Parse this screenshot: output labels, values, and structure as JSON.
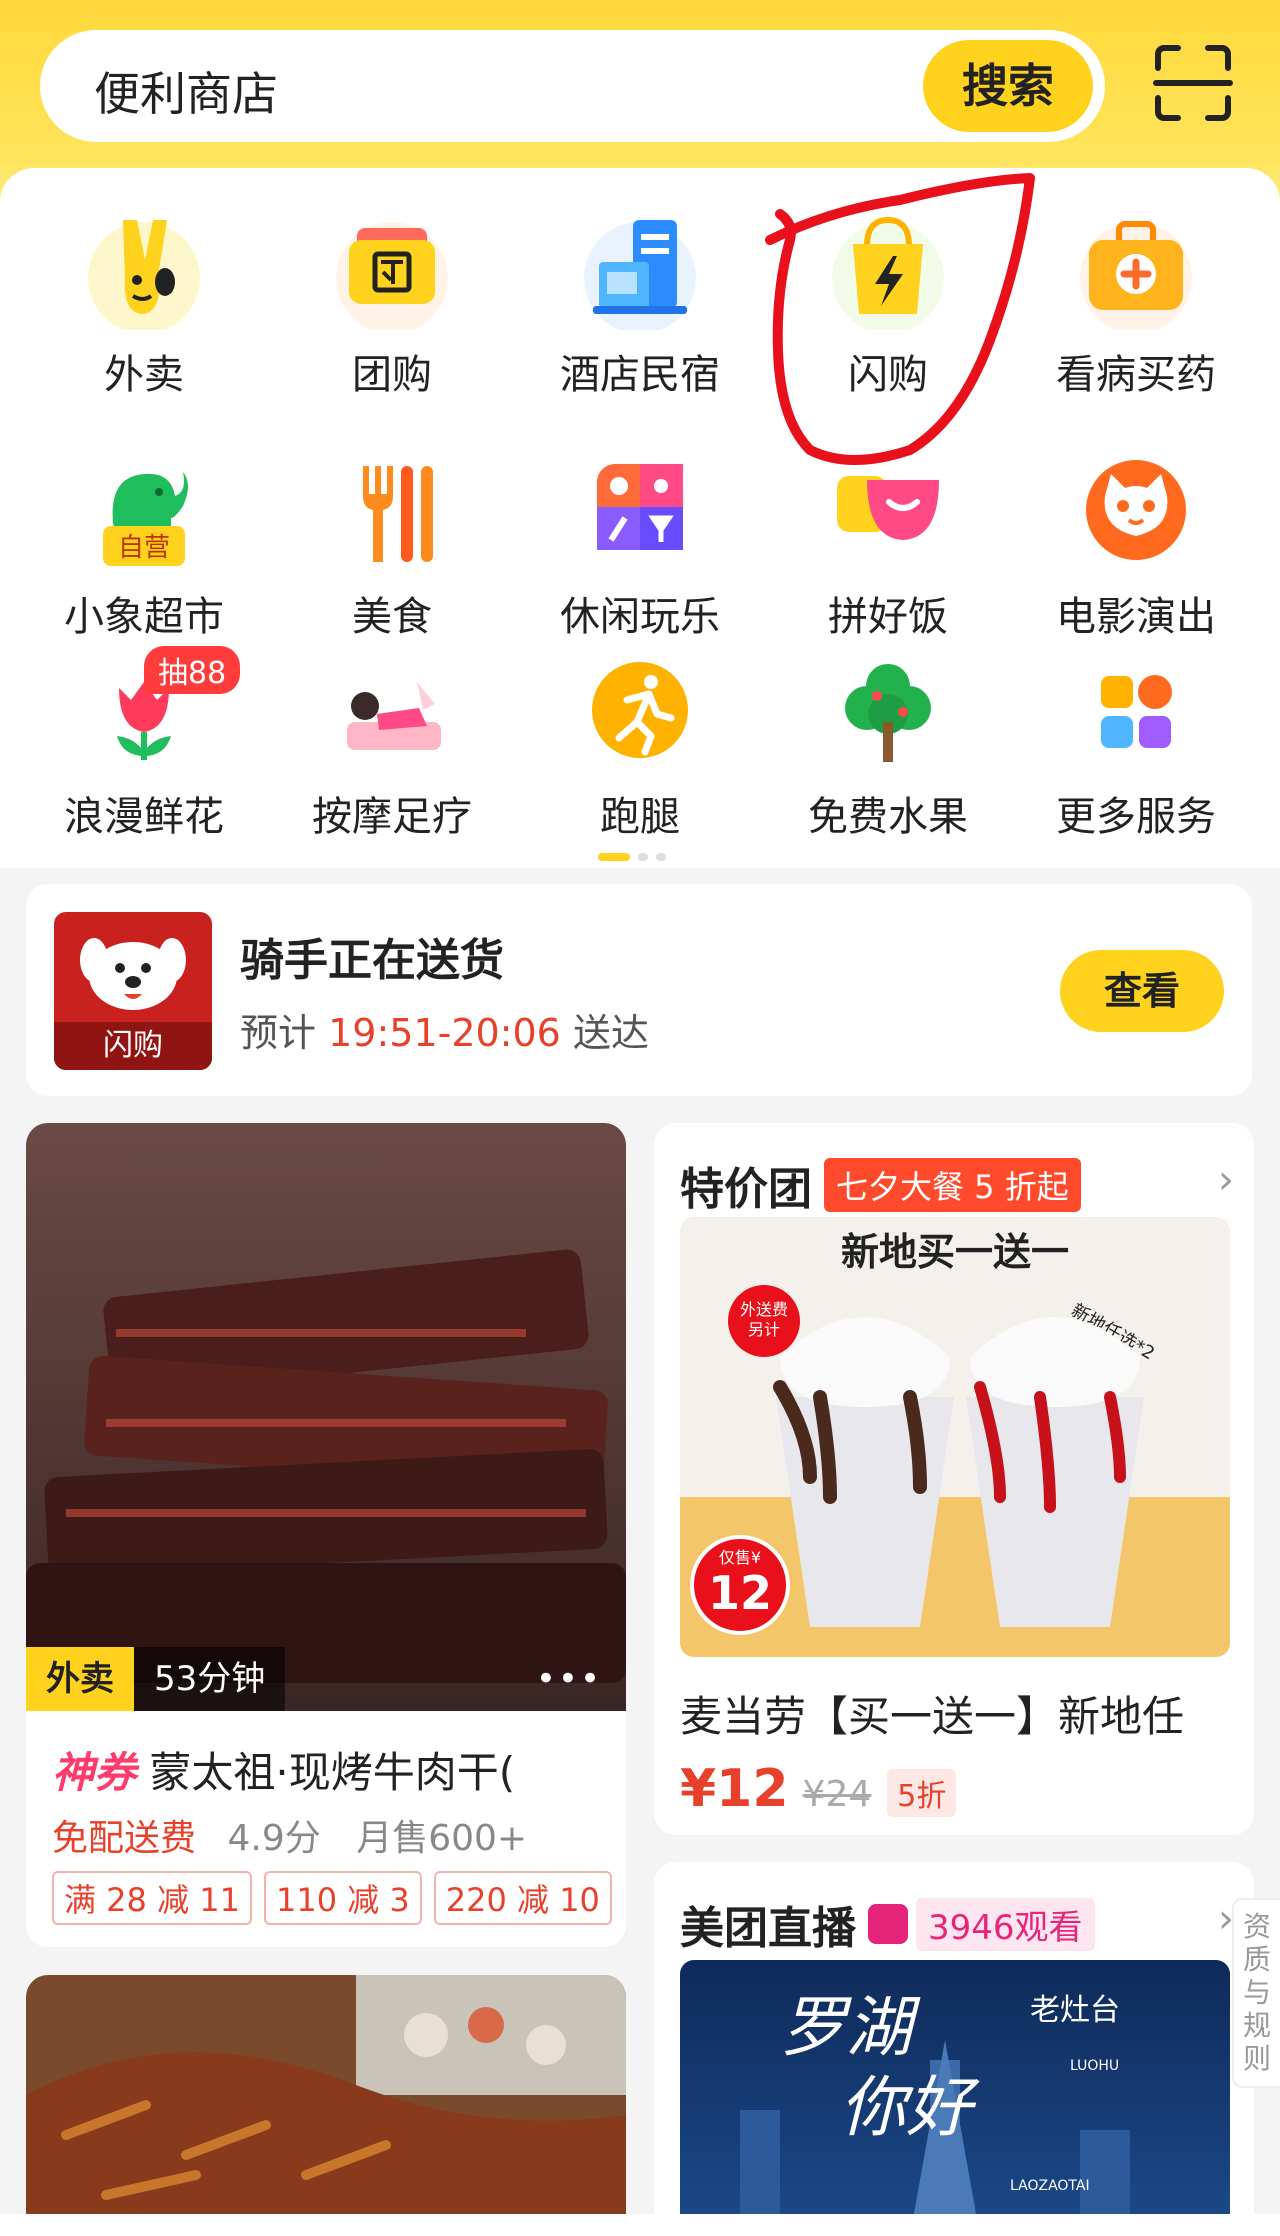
{
  "search": {
    "value": "便利商店",
    "button": "搜索"
  },
  "services": [
    {
      "label": "外卖",
      "icon": "waimai-icon"
    },
    {
      "label": "团购",
      "icon": "tuangou-icon"
    },
    {
      "label": "酒店民宿",
      "icon": "hotel-icon"
    },
    {
      "label": "闪购",
      "icon": "flash-buy-icon"
    },
    {
      "label": "看病买药",
      "icon": "medicine-kit-icon"
    },
    {
      "label": "小象超市",
      "icon": "elephant-icon",
      "badge": "自营"
    },
    {
      "label": "美食",
      "icon": "fork-knife-icon"
    },
    {
      "label": "休闲玩乐",
      "icon": "leisure-icon"
    },
    {
      "label": "拼好饭",
      "icon": "meal-bowl-icon"
    },
    {
      "label": "电影演出",
      "icon": "cat-face-icon"
    },
    {
      "label": "浪漫鲜花",
      "icon": "tulip-icon",
      "badge": "抽88"
    },
    {
      "label": "按摩足疗",
      "icon": "massage-icon"
    },
    {
      "label": "跑腿",
      "icon": "runner-icon"
    },
    {
      "label": "免费水果",
      "icon": "tree-icon"
    },
    {
      "label": "更多服务",
      "icon": "grid-apps-icon"
    }
  ],
  "delivery": {
    "logo_tag": "闪购",
    "title": "骑手正在送货",
    "eta_prefix": "预计",
    "eta_time": "19:51-20:06",
    "eta_suffix": "送达",
    "button": "查看"
  },
  "feed_left": {
    "tag_type": "外卖",
    "tag_time": "53分钟",
    "more": "•••",
    "coupon_label": "神券",
    "title": "蒙太祖·现烤牛肉干(",
    "free_delivery": "免配送费",
    "rating": "4.9分",
    "monthly_sales": "月售600+",
    "coupons": [
      "满 28 减 11",
      "110 减 3",
      "220 减 10"
    ]
  },
  "feed_right": {
    "heading": "特价团",
    "badge": "七夕大餐 5 折起",
    "chevron": "›",
    "image_headline": "新地买一送一",
    "image_fee": "外送费\n另计",
    "image_price_label": "仅售¥",
    "image_price": "12",
    "image_side": "新地任选*2",
    "name": "麦当劳【买一送一】新地任",
    "price_now": "¥12",
    "price_was": "¥24",
    "discount": "5折"
  },
  "live": {
    "heading": "美团直播",
    "views": "3946观看",
    "chevron": "›",
    "image_text_1": "罗湖",
    "image_text_2": "你好",
    "image_brand": "老灶台",
    "image_brand_sub": "LUOHU",
    "image_footer": "LAOZAOTAI"
  },
  "side_tab": "资质与规则",
  "colors": {
    "brand_yellow": "#ffd21e",
    "accent_red": "#e8412b",
    "annotation_red": "#e8101a"
  }
}
